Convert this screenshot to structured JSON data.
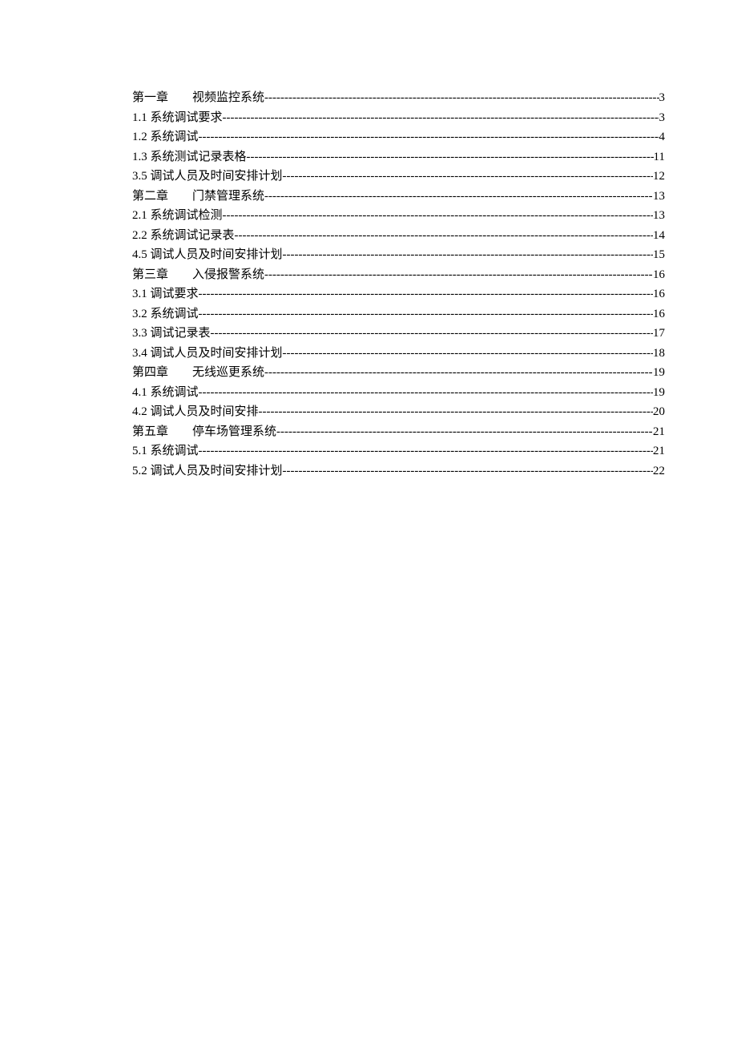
{
  "toc": [
    {
      "label": "第一章",
      "title": "视频监控系统",
      "page": "3",
      "is_chapter": true
    },
    {
      "label": "1.1 系统调试要求 ",
      "title": "",
      "page": "3",
      "is_chapter": false
    },
    {
      "label": "1.2 系统调试 ",
      "title": "",
      "page": "4",
      "is_chapter": false
    },
    {
      "label": "1.3 系统测试记录表格",
      "title": "",
      "page": "11",
      "is_chapter": false
    },
    {
      "label": "3.5 调试人员及时间安排计划 ",
      "title": "",
      "page": "12",
      "is_chapter": false
    },
    {
      "label": "第二章",
      "title": "门禁管理系统 ",
      "page": "13",
      "is_chapter": true
    },
    {
      "label": "2.1 系统调试检测",
      "title": "",
      "page": "13",
      "is_chapter": false
    },
    {
      "label": "2.2 系统调试记录表",
      "title": "",
      "page": "14",
      "is_chapter": false
    },
    {
      "label": "4.5 调试人员及时间安排计划 ",
      "title": "",
      "page": "15",
      "is_chapter": false
    },
    {
      "label": "第三章",
      "title": "入侵报警系统 ",
      "page": "16",
      "is_chapter": true
    },
    {
      "label": "3.1 调试要求",
      "title": "",
      "page": "16",
      "is_chapter": false
    },
    {
      "label": "3.2 系统调试",
      "title": "",
      "page": "16",
      "is_chapter": false
    },
    {
      "label": "3.3 调试记录表",
      "title": "",
      "page": "17",
      "is_chapter": false
    },
    {
      "label": "3.4 调试人员及时间安排计划 ",
      "title": "",
      "page": "18",
      "is_chapter": false
    },
    {
      "label": "第四章",
      "title": "无线巡更系统 ",
      "page": "19",
      "is_chapter": true
    },
    {
      "label": "4.1 系统调试",
      "title": "",
      "page": "19",
      "is_chapter": false
    },
    {
      "label": "4.2 调试人员及时间安排",
      "title": "",
      "page": "20",
      "is_chapter": false
    },
    {
      "label": "第五章",
      "title": "停车场管理系统 ",
      "page": "21",
      "is_chapter": true
    },
    {
      "label": "5.1 系统调试",
      "title": "",
      "page": "21",
      "is_chapter": false
    },
    {
      "label": "5.2 调试人员及时间安排计划 ",
      "title": "",
      "page": "22",
      "is_chapter": false
    }
  ]
}
